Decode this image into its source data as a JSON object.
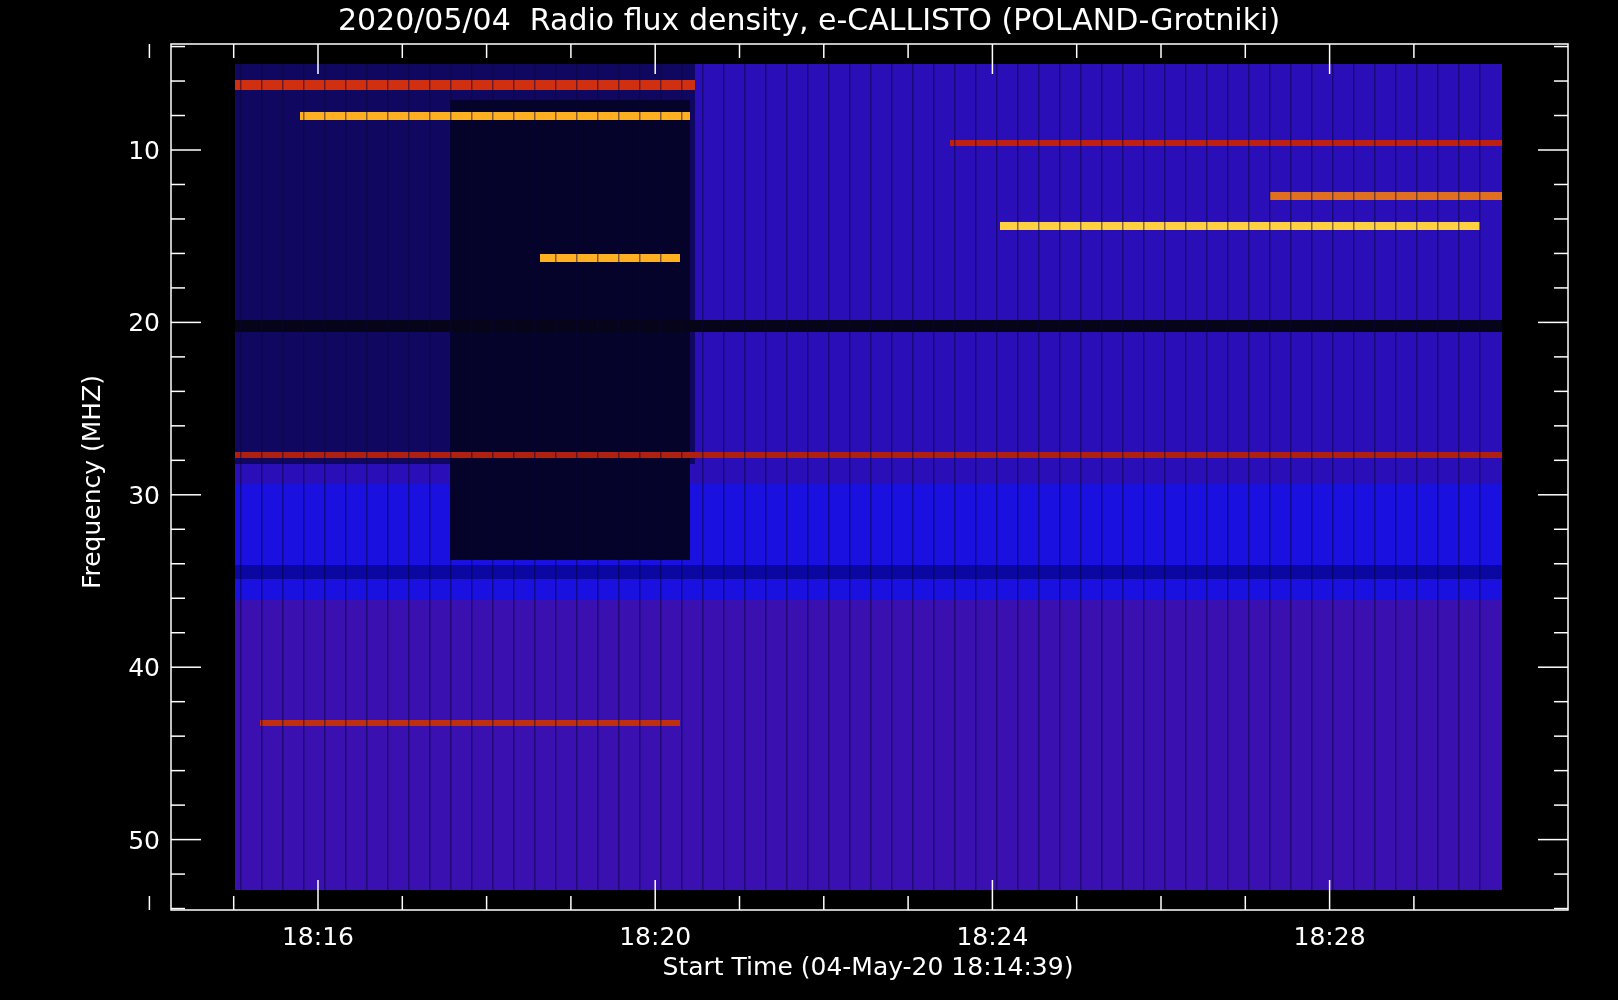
{
  "title": "2020/05/04  Radio flux density, e-CALLISTO (POLAND-Grotniki)",
  "plot": {
    "xlabel": "Start Time (04-May-20 18:14:39)",
    "ylabel": "Frequency (MHZ)",
    "xticks": [
      "18:16",
      "18:20",
      "18:24",
      "18:28"
    ],
    "yticks": [
      "10",
      "20",
      "30",
      "40",
      "50"
    ]
  }
}
